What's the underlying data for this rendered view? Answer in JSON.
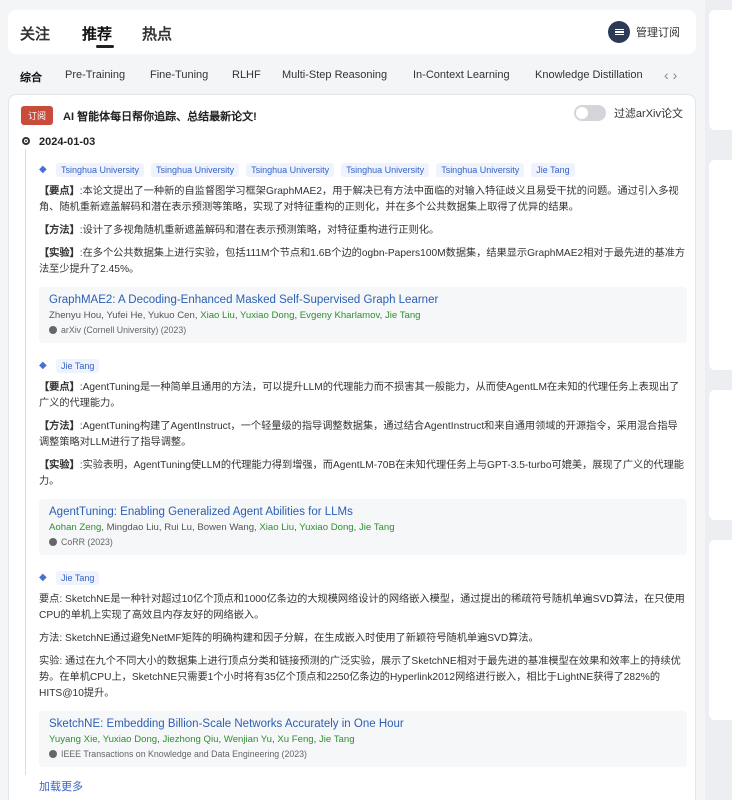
{
  "nav": {
    "tabs": [
      "关注",
      "推荐",
      "热点"
    ],
    "active_tab": "推荐",
    "manage_label": "管理订阅"
  },
  "categories": [
    "综合",
    "Pre-Training",
    "Fine-Tuning",
    "RLHF",
    "Multi-Step Reasoning",
    "In-Context Learning",
    "Knowledge Distillation"
  ],
  "active_category": "综合",
  "subscription": {
    "badge": "订阅",
    "text": "AI 智能体每日帮你追踪、总结最新论文!",
    "filter_label": "过滤arXiv论文",
    "filter_on": false
  },
  "date": "2024-01-03",
  "papers": [
    {
      "tags": [
        "Tsinghua University",
        "Tsinghua University",
        "Tsinghua University",
        "Tsinghua University",
        "Tsinghua University",
        "Jie Tang"
      ],
      "p1_label": "【要点】",
      "p1": ":本论文提出了一种新的自监督图学习框架GraphMAE2，用于解决已有方法中面临的对输入特征歧义且易受干扰的问题。通过引入多视角、随机重新遮盖解码和潜在表示预测等策略，实现了对特征重构的正则化，并在多个公共数据集上取得了优异的结果。",
      "p2_label": "【方法】",
      "p2": ":设计了多视角随机重新遮盖解码和潜在表示预测策略，对特征重构进行正则化。",
      "p3_label": "【实验】",
      "p3": ":在多个公共数据集上进行实验，包括111M个节点和1.6B个边的ogbn-Papers100M数据集，结果显示GraphMAE2相对于最先进的基准方法至少提升了2.45%。",
      "title": "GraphMAE2: A Decoding-Enhanced Masked Self-Supervised Graph Learner",
      "authors": [
        "Zhenyu Hou",
        "Yufei He",
        "Yukuo Cen",
        "Xiao Liu",
        "Yuxiao Dong",
        "Evgeny Kharlamov",
        "Jie Tang"
      ],
      "venue": "arXiv (Cornell University) (2023)"
    },
    {
      "tags": [
        "Jie Tang"
      ],
      "p1_label": "【要点】",
      "p1": ":AgentTuning是一种简单且通用的方法，可以提升LLM的代理能力而不损害其一般能力，从而使AgentLM在未知的代理任务上表现出了广义的代理能力。",
      "p2_label": "【方法】",
      "p2": ":AgentTuning构建了AgentInstruct，一个轻量级的指导调整数据集，通过结合AgentInstruct和来自通用领域的开源指令，采用混合指导调整策略对LLM进行了指导调整。",
      "p3_label": "【实验】",
      "p3": ":实验表明，AgentTuning使LLM的代理能力得到增强，而AgentLM-70B在未知代理任务上与GPT-3.5-turbo可媲美，展现了广义的代理能力。",
      "title": "AgentTuning: Enabling Generalized Agent Abilities for LLMs",
      "authors": [
        "Aohan Zeng",
        "Mingdao Liu",
        "Rui Lu",
        "Bowen Wang",
        "Xiao Liu",
        "Yuxiao Dong",
        "Jie Tang"
      ],
      "venue": "CoRR (2023)"
    },
    {
      "tags": [
        "Jie Tang"
      ],
      "p1_label": "要点",
      "p1": ": SketchNE是一种针对超过10亿个顶点和1000亿条边的大规模网络设计的网络嵌入模型，通过提出的稀疏符号随机单遍SVD算法，在只使用CPU的单机上实现了高效且内存友好的网络嵌入。",
      "p2_label": "方法",
      "p2": ": SketchNE通过避免NetMF矩阵的明确构建和因子分解，在生成嵌入时使用了新颖符号随机单遍SVD算法。",
      "p3_label": "实验",
      "p3": ": 通过在九个不同大小的数据集上进行顶点分类和链接预测的广泛实验，展示了SketchNE相对于最先进的基准模型在效果和效率上的持续优势。在单机CPU上，SketchNE只需要1个小时将有35亿个顶点和2250亿条边的Hyperlink2012网络进行嵌入，相比于LightNE获得了282%的HITS@10提升。",
      "title": "SketchNE: Embedding Billion-Scale Networks Accurately in One Hour",
      "authors": [
        "Yuyang Xie",
        "Yuxiao Dong",
        "Jiezhong Qiu",
        "Wenjian Yu",
        "Xu Feng",
        "Jie Tang"
      ],
      "venue": "IEEE Transactions on Knowledge and Data Engineering (2023)"
    }
  ],
  "highlight_authors": [
    "Xiao Liu",
    "Yuxiao Dong",
    "Evgeny Kharlamov",
    "Jie Tang",
    "Aohan Zeng",
    "Yuyang Xie",
    "Jiezhong Qiu",
    "Wenjian Yu",
    "Xu Feng"
  ],
  "load_more": "加载更多",
  "colors": {
    "accent": "#3763c7",
    "badge": "#c94b3a",
    "author_highlight": "#2f8f2f"
  }
}
